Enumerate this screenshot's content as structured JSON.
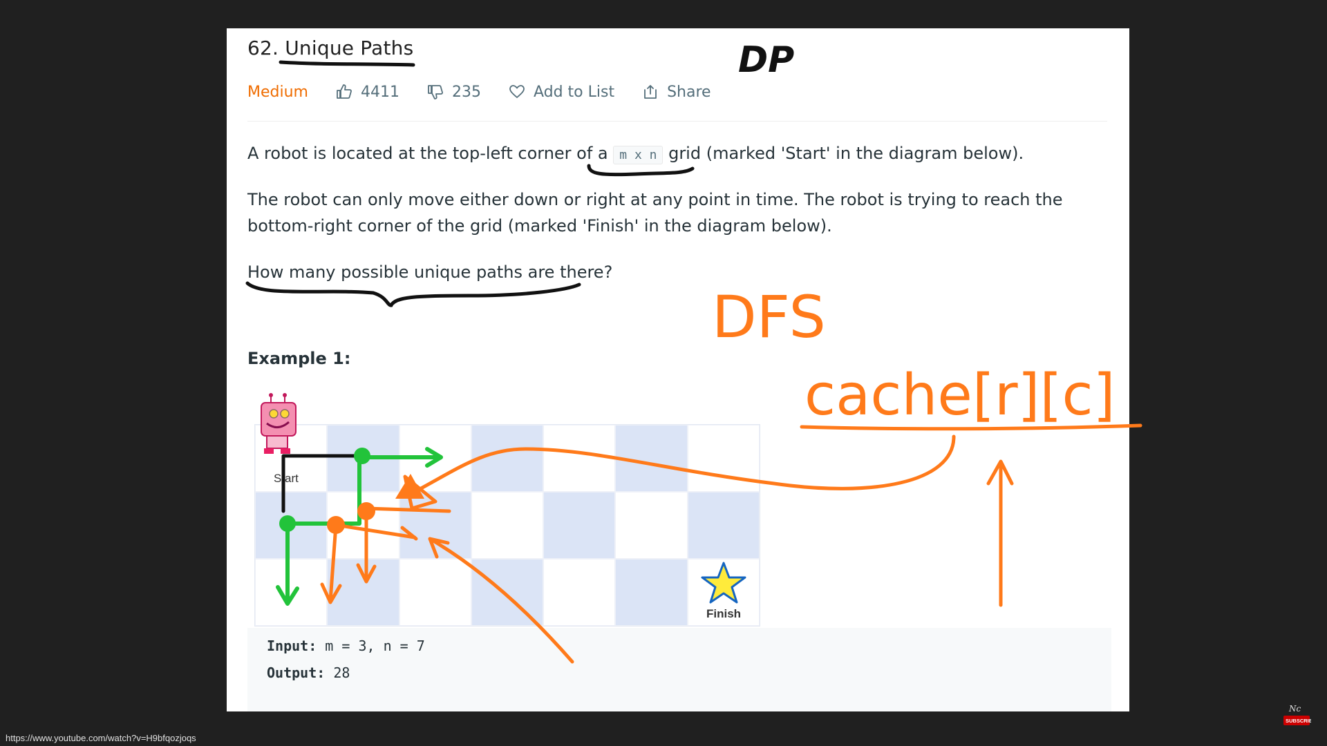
{
  "problem": {
    "title": "62. Unique Paths",
    "difficulty": "Medium",
    "likes": "4411",
    "dislikes": "235",
    "add_to_list": "Add to List",
    "share": "Share",
    "p1_before": "A robot is located at the top-left corner of a ",
    "p1_code": "m x n",
    "p1_after": " grid (marked 'Start' in the diagram below).",
    "p2": "The robot can only move either down or right at any point in time. The robot is trying to reach the bottom-right corner of the grid (marked 'Finish' in the diagram below).",
    "p3": "How many possible unique paths are there?",
    "example_title": "Example 1:",
    "start_label": "Start",
    "finish_label": "Finish",
    "input_label": "Input:",
    "input_value": " m = 3, n = 7",
    "output_label": "Output:",
    "output_value": " 28"
  },
  "annotations": {
    "dp": "DP",
    "dfs": "DFS",
    "cache": "cache[r][c]"
  },
  "status_url": "https://www.youtube.com/watch?v=H9bfqozjoqs",
  "colors": {
    "accent_orange": "#ff7a1a",
    "green": "#22c33a",
    "difficulty": "#ef6c00",
    "grid_shade": "#dbe4f6"
  },
  "icons": [
    "thumbs-up-icon",
    "thumbs-down-icon",
    "heart-icon",
    "share-icon",
    "robot-icon",
    "star-icon",
    "subscribe-icon"
  ]
}
